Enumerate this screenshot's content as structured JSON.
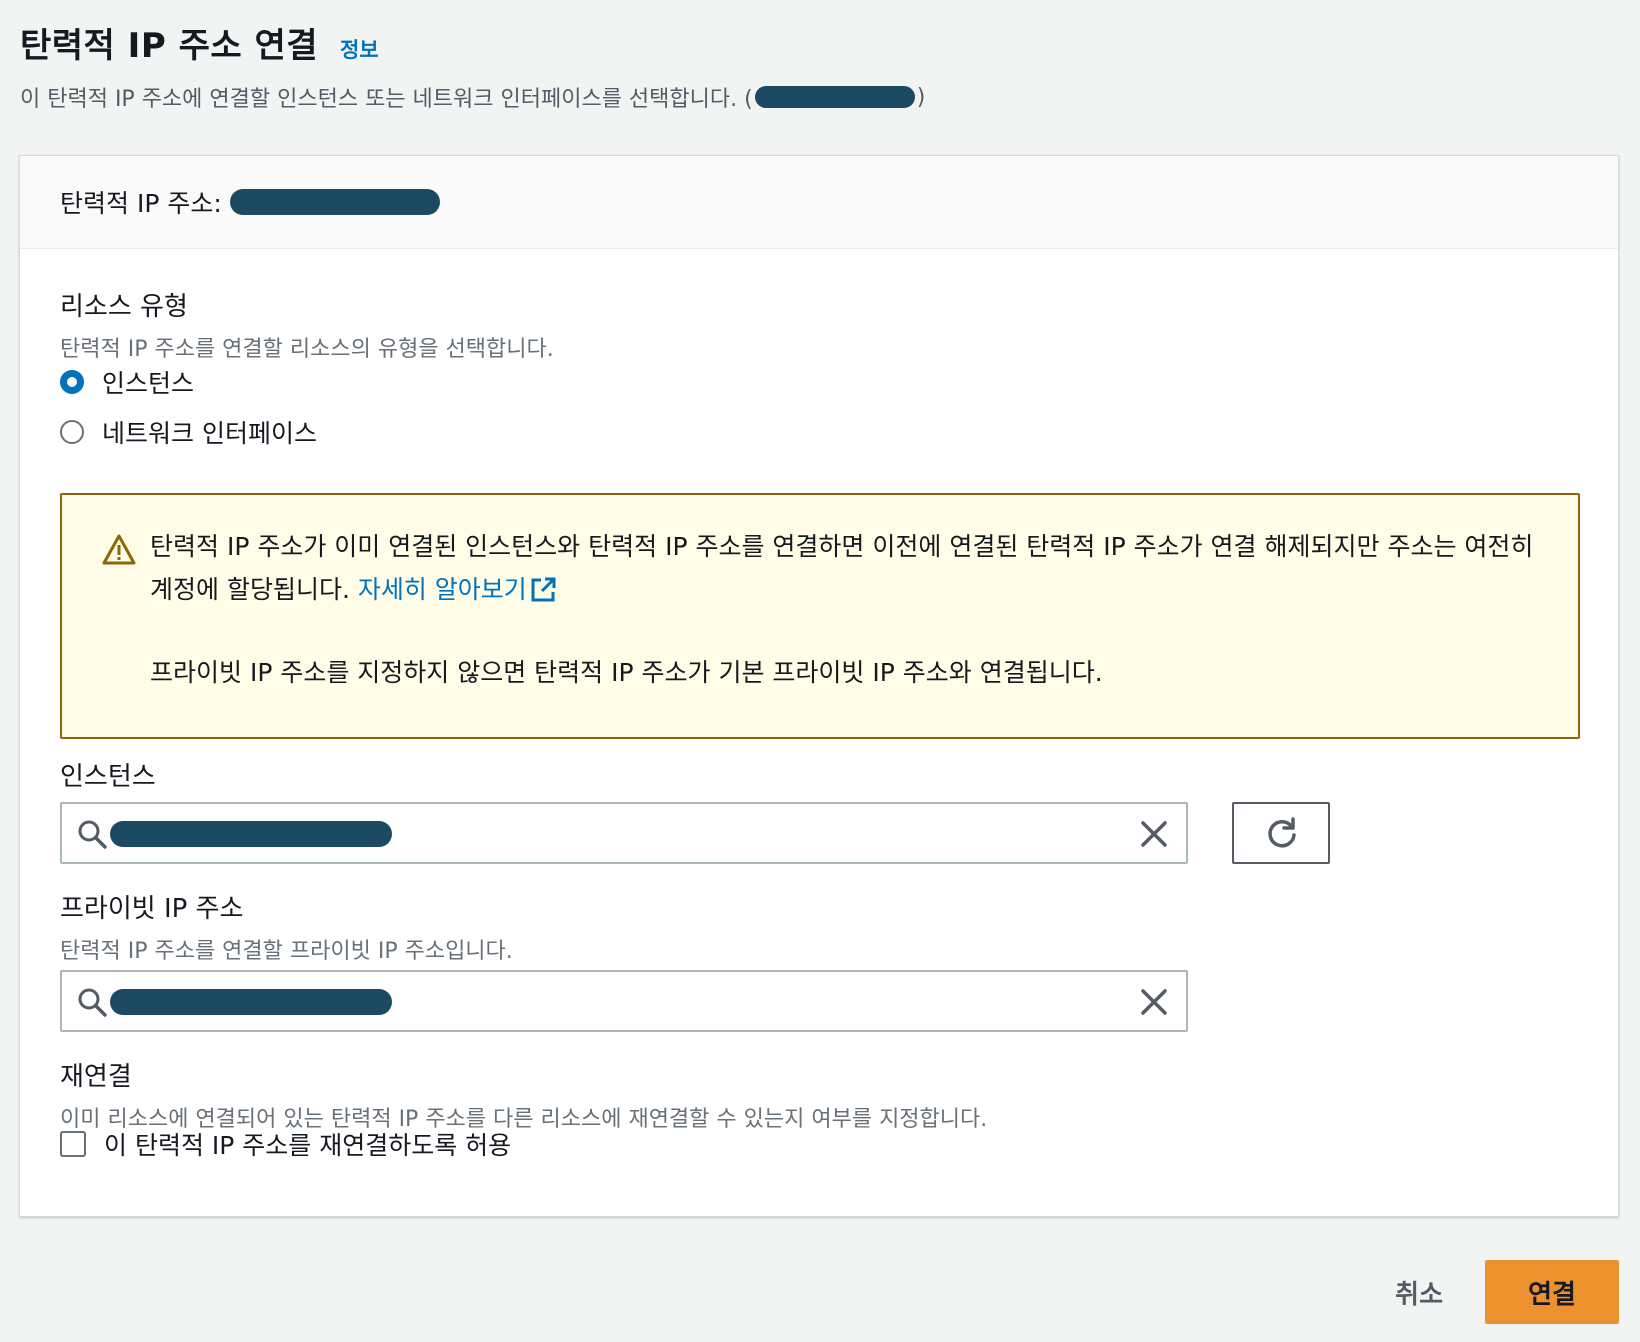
{
  "header": {
    "title": "탄력적 IP 주소 연결",
    "info_link": "정보",
    "description_prefix": "이 탄력적 IP 주소에 연결할 인스턴스 또는 네트워크 인터페이스를 선택합니다. (",
    "description_suffix": ")"
  },
  "panel": {
    "elastic_ip_label": "탄력적 IP 주소:"
  },
  "resource_type": {
    "label": "리소스 유형",
    "description": "탄력적 IP 주소를 연결할 리소스의 유형을 선택합니다.",
    "options": [
      {
        "label": "인스턴스",
        "checked": true
      },
      {
        "label": "네트워크 인터페이스",
        "checked": false
      }
    ]
  },
  "alert": {
    "text1": "탄력적 IP 주소가 이미 연결된 인스턴스와 탄력적 IP 주소를 연결하면 이전에 연결된 탄력적 IP 주소가 연결 해제되지만 주소는 여전히 계정에 할당됩니다. ",
    "link": "자세히 알아보기",
    "text2": "프라이빗 IP 주소를 지정하지 않으면 탄력적 IP 주소가 기본 프라이빗 IP 주소와 연결됩니다."
  },
  "instance": {
    "label": "인스턴스"
  },
  "private_ip": {
    "label": "프라이빗 IP 주소",
    "description": "탄력적 IP 주소를 연결할 프라이빗 IP 주소입니다."
  },
  "reassociation": {
    "label": "재연결",
    "description": "이미 리소스에 연결되어 있는 탄력적 IP 주소를 다른 리소스에 재연결할 수 있는지 여부를 지정합니다.",
    "checkbox_label": "이 탄력적 IP 주소를 재연결하도록 허용",
    "checked": false
  },
  "footer": {
    "cancel": "취소",
    "submit": "연결"
  },
  "colors": {
    "accent": "#0073bb",
    "primary_button": "#ec912d",
    "warning_border": "#8d6605",
    "warning_bg": "#fffce8",
    "redaction": "#1d4a63"
  },
  "icons": [
    "warning-icon",
    "external-link-icon",
    "search-icon",
    "close-icon",
    "refresh-icon"
  ]
}
